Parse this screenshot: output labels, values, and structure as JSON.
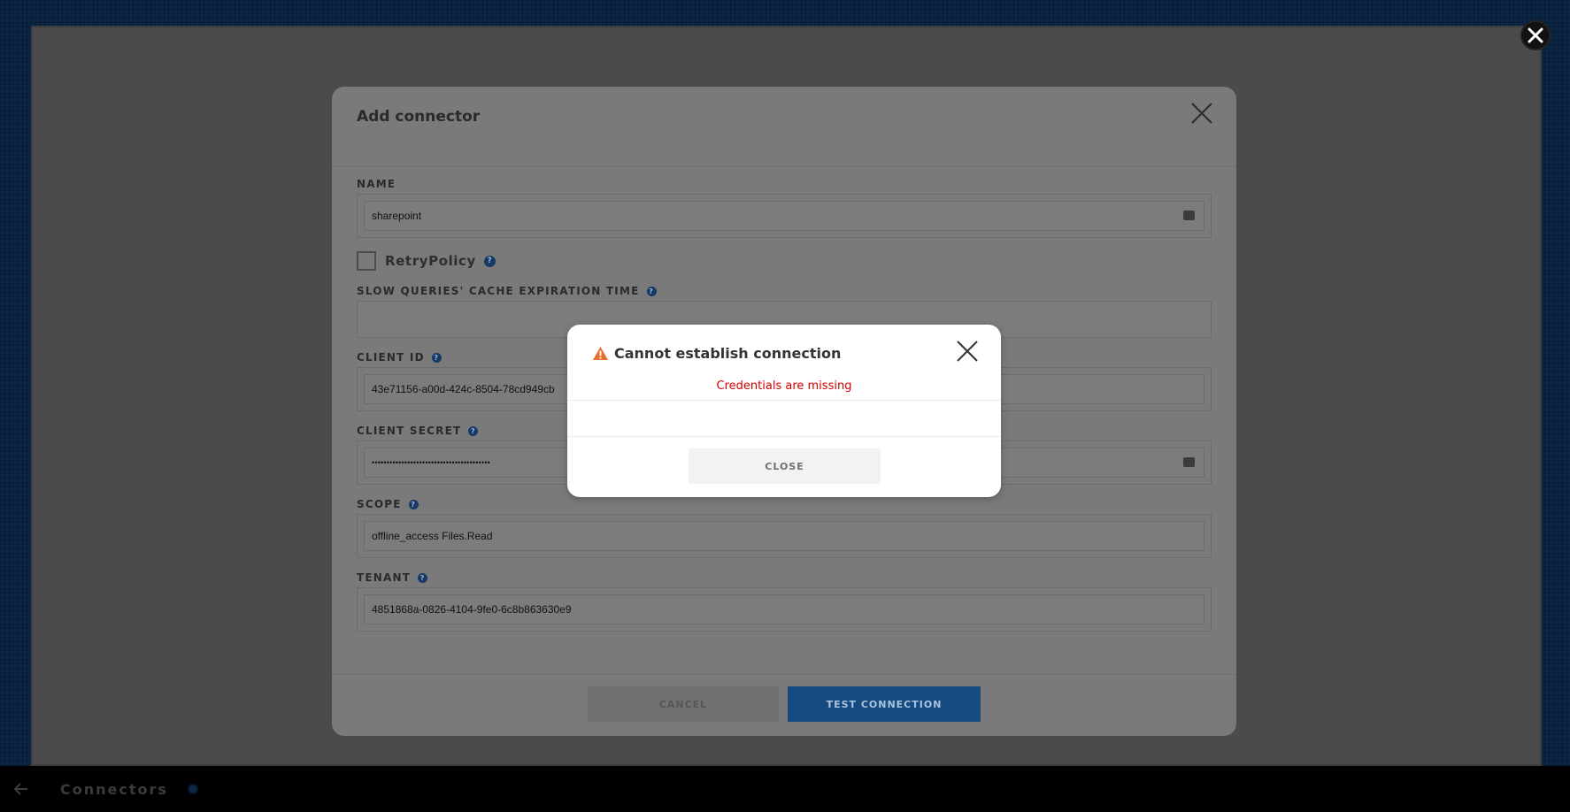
{
  "bottombar": {
    "title": "Connectors"
  },
  "dialog": {
    "title": "Add connector",
    "fields": {
      "name": {
        "label": "NAME",
        "value": "sharepoint"
      },
      "retry": {
        "label": "RetryPolicy",
        "checked": false
      },
      "cache": {
        "label": "SLOW QUERIES' CACHE EXPIRATION TIME",
        "value": ""
      },
      "client_id": {
        "label": "CLIENT ID",
        "value": "43e71156-a00d-424c-8504-78cd949cb"
      },
      "client_secret": {
        "label": "CLIENT SECRET",
        "value": "••••••••••••••••••••••••••••••••••••••••"
      },
      "scope": {
        "label": "SCOPE",
        "value": "offline_access Files.Read"
      },
      "tenant": {
        "label": "TENANT",
        "value": "4851868a-0826-4104-9fe0-6c8b863630e9"
      }
    },
    "cancel_label": "CANCEL",
    "test_label": "TEST CONNECTION"
  },
  "alert": {
    "title": "Cannot establish connection",
    "message": "Credentials are missing",
    "close_label": "CLOSE"
  },
  "icons": {
    "help": "help-icon",
    "keyboard": "keyboard-icon",
    "warning": "warning-icon",
    "close": "close-icon",
    "back": "back-arrow-icon"
  },
  "colors": {
    "primary": "#164b80",
    "error": "#d30000",
    "warning": "#e8702a"
  }
}
